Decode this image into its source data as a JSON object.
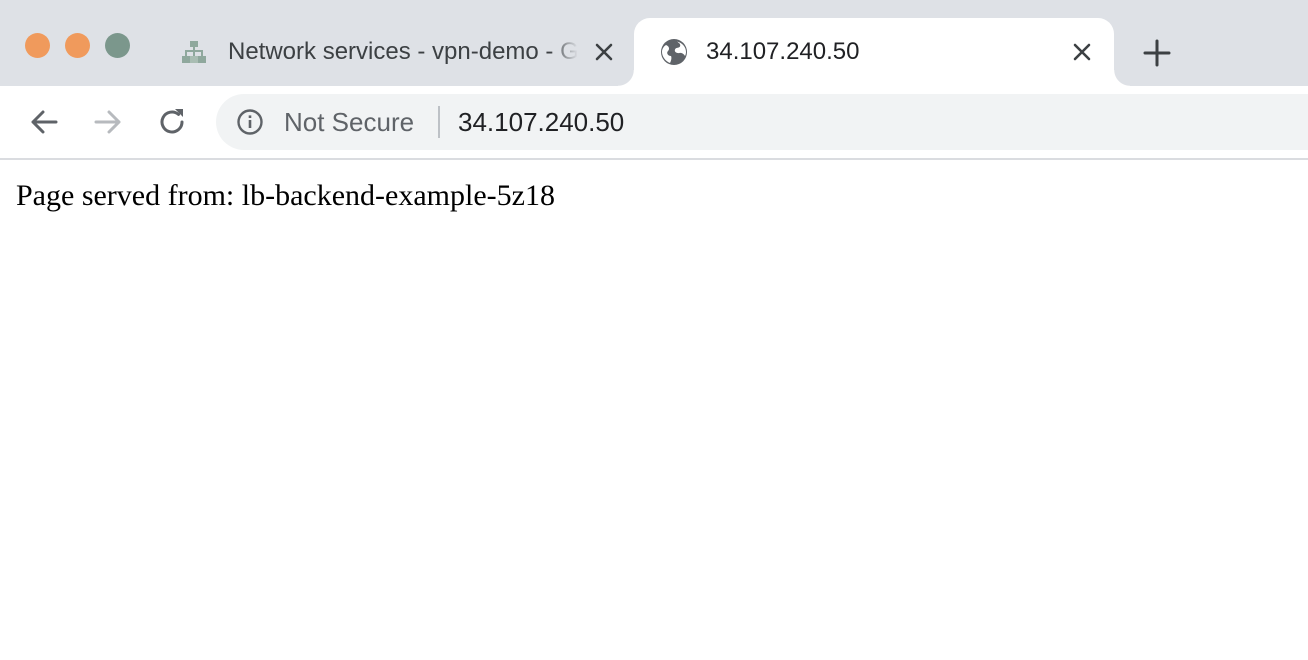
{
  "window": {
    "controls": {
      "close_color": "#f09a5c",
      "minimize_color": "#f09a5c",
      "maximize_color": "#7b978c"
    }
  },
  "tabs": [
    {
      "title": "Network services - vpn-demo - Google Cloud Platform",
      "favicon": "network-services-icon",
      "active": false
    },
    {
      "title": "34.107.240.50",
      "favicon": "globe-icon",
      "active": true
    }
  ],
  "toolbar": {
    "back_icon": "arrow-left-icon",
    "forward_icon": "arrow-right-icon",
    "reload_icon": "reload-icon",
    "new_tab_icon": "plus-icon"
  },
  "omnibox": {
    "security_icon": "info-icon",
    "security_label": "Not Secure",
    "url": "34.107.240.50"
  },
  "page": {
    "text": "Page served from: lb-backend-example-5z18"
  }
}
